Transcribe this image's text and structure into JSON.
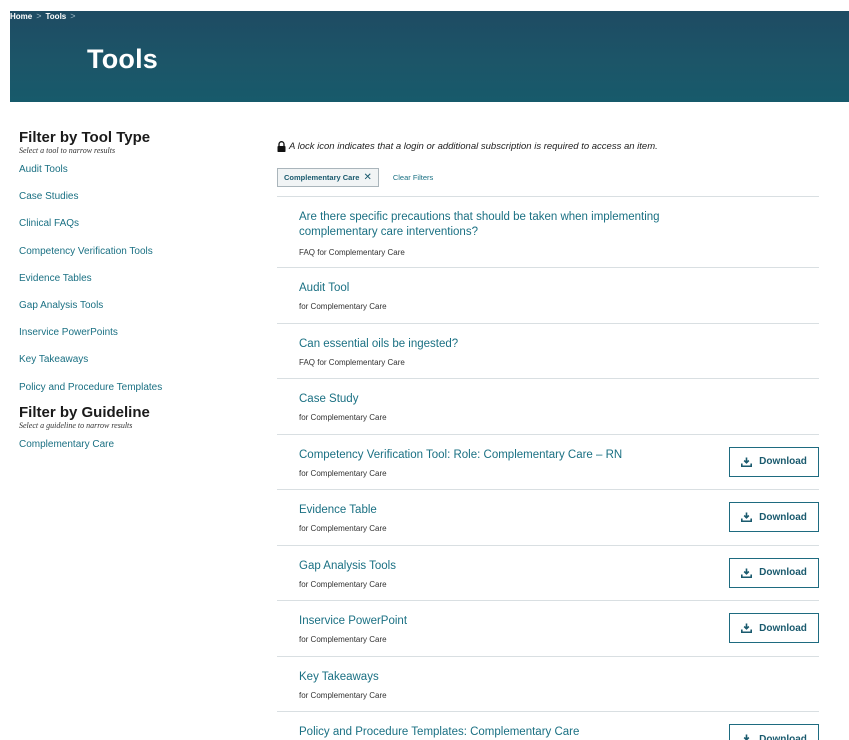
{
  "breadcrumb": {
    "home": "Home",
    "sep": ">",
    "tools": "Tools"
  },
  "page_title": "Tools",
  "sidebar": {
    "tool_type": {
      "heading": "Filter by Tool Type",
      "subheading": "Select a tool to narrow results",
      "items": [
        "Audit Tools",
        "Case Studies",
        "Clinical FAQs",
        "Competency Verification Tools",
        "Evidence Tables",
        "Gap Analysis Tools",
        "Inservice PowerPoints",
        "Key Takeaways",
        "Policy and Procedure Templates"
      ]
    },
    "guideline": {
      "heading": "Filter by Guideline",
      "subheading": "Select a guideline to narrow results",
      "items": [
        "Complementary Care"
      ]
    }
  },
  "notice": "A lock icon indicates that a login or additional subscription is required to access an item.",
  "active_filter": {
    "label": "Complementary Care",
    "remove": "✕"
  },
  "clear_filters": "Clear Filters",
  "download_label": "Download",
  "results": [
    {
      "title": "Are there specific precautions that should be taken when implementing complementary care interventions?",
      "sub": "FAQ for Complementary Care",
      "download": false
    },
    {
      "title": "Audit Tool",
      "sub": "for Complementary Care",
      "download": false
    },
    {
      "title": "Can essential oils be ingested?",
      "sub": "FAQ for Complementary Care",
      "download": false
    },
    {
      "title": "Case Study",
      "sub": "for Complementary Care",
      "download": false
    },
    {
      "title": "Competency Verification Tool: Role: Complementary Care – RN",
      "sub": "for Complementary Care",
      "download": true
    },
    {
      "title": "Evidence Table",
      "sub": "for Complementary Care",
      "download": true
    },
    {
      "title": "Gap Analysis Tools",
      "sub": "for Complementary Care",
      "download": true
    },
    {
      "title": "Inservice PowerPoint",
      "sub": "for Complementary Care",
      "download": true
    },
    {
      "title": "Key Takeaways",
      "sub": "for Complementary Care",
      "download": false
    },
    {
      "title": "Policy and Procedure Templates: Complementary Care",
      "sub": "",
      "download": true
    }
  ],
  "colors": {
    "header": "#1c5568",
    "link": "#1a7083"
  },
  "icons": {
    "lock": "lock-icon",
    "download": "download-icon",
    "remove": "close-icon"
  }
}
